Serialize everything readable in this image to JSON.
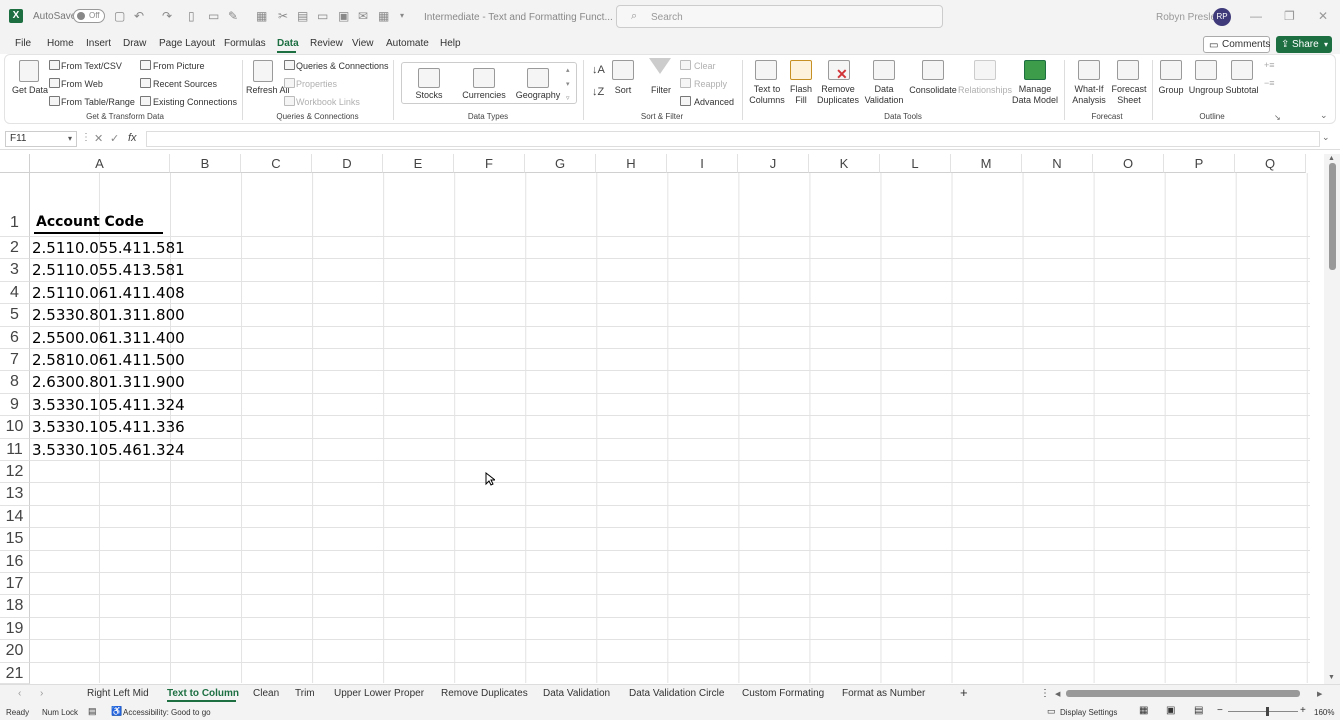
{
  "titlebar": {
    "autosave_label": "AutoSave",
    "autosave_state": "Off",
    "doc_title": "Intermediate - Text and Formatting Funct...",
    "search_placeholder": "Search",
    "user_name": "Robyn Presley",
    "user_initials": "RP"
  },
  "menu": {
    "items": [
      "File",
      "Home",
      "Insert",
      "Draw",
      "Page Layout",
      "Formulas",
      "Data",
      "Review",
      "View",
      "Automate",
      "Help"
    ],
    "active": "Data",
    "comments_label": "Comments",
    "share_label": "Share"
  },
  "ribbon": {
    "get_data": "Get Data",
    "from_text_csv": "From Text/CSV",
    "from_web": "From Web",
    "from_table_range": "From Table/Range",
    "from_picture": "From Picture",
    "recent_sources": "Recent Sources",
    "existing_connections": "Existing Connections",
    "group_get_transform": "Get & Transform Data",
    "refresh_all": "Refresh All",
    "queries_connections": "Queries & Connections",
    "properties": "Properties",
    "workbook_links": "Workbook Links",
    "group_queries": "Queries & Connections",
    "stocks": "Stocks",
    "currencies": "Currencies",
    "geography": "Geography",
    "group_data_types": "Data Types",
    "sort": "Sort",
    "filter": "Filter",
    "clear": "Clear",
    "reapply": "Reapply",
    "advanced": "Advanced",
    "group_sort_filter": "Sort & Filter",
    "text_to_columns": "Text to Columns",
    "flash_fill": "Flash Fill",
    "remove_duplicates": "Remove Duplicates",
    "data_validation": "Data Validation",
    "consolidate": "Consolidate",
    "relationships": "Relationships",
    "manage_data_model": "Manage Data Model",
    "group_data_tools": "Data Tools",
    "what_if": "What-If Analysis",
    "forecast_sheet": "Forecast Sheet",
    "group_forecast": "Forecast",
    "group": "Group",
    "ungroup": "Ungroup",
    "subtotal": "Subtotal",
    "group_outline": "Outline"
  },
  "formula_bar": {
    "name_box": "F11",
    "fx": "fx",
    "content": ""
  },
  "grid": {
    "columns": [
      "A",
      "B",
      "C",
      "D",
      "E",
      "F",
      "G",
      "H",
      "I",
      "J",
      "K",
      "L",
      "M",
      "N",
      "O",
      "P",
      "Q"
    ],
    "rows": [
      "1",
      "2",
      "3",
      "4",
      "5",
      "6",
      "7",
      "8",
      "9",
      "10",
      "11",
      "12",
      "13",
      "14",
      "15",
      "16",
      "17",
      "18",
      "19",
      "20",
      "21"
    ],
    "header_cell": "Account Code",
    "values": [
      "2.5110.055.411.581",
      "2.5110.055.413.581",
      "2.5110.061.411.408",
      "2.5330.801.311.800",
      "2.5500.061.311.400",
      "2.5810.061.411.500",
      "2.6300.801.311.900",
      "3.5330.105.411.324",
      "3.5330.105.411.336",
      "3.5330.105.461.324"
    ]
  },
  "sheet_tabs": {
    "tabs": [
      "Right Left Mid",
      "Text to Column",
      "Clean",
      "Trim",
      "Upper Lower Proper",
      "Remove Duplicates",
      "Data Validation",
      "Data Validation Circle",
      "Custom Formating",
      "Format as Number"
    ],
    "active": "Text to Column"
  },
  "status": {
    "ready": "Ready",
    "num_lock": "Num Lock",
    "accessibility": "Accessibility: Good to go",
    "display_settings": "Display Settings",
    "zoom": "160%"
  },
  "colors": {
    "accent": "#1d6f42"
  }
}
